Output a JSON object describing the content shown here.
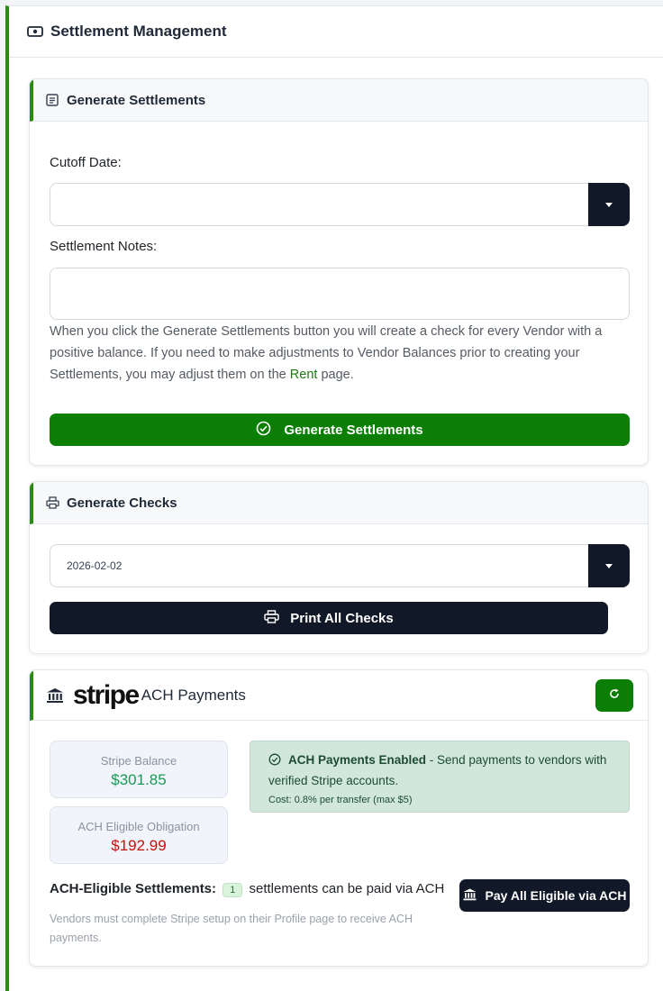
{
  "page": {
    "title": "Settlement Management",
    "icon": "money-icon"
  },
  "generate_settlements": {
    "title": "Generate Settlements",
    "icon": "document-icon",
    "cutoff_label": "Cutoff Date:",
    "cutoff_value": "",
    "notes_label": "Settlement Notes:",
    "notes_value": "",
    "help_before": "When you click the Generate Settlements button you will create a check for every Vendor with a positive balance. If you need to make adjustments to Vendor Balances prior to creating your Settlements, you may adjust them on the ",
    "help_link": "Rent",
    "help_after": " page.",
    "button_label": "Generate Settlements",
    "button_icon": "check-circle-icon"
  },
  "generate_checks": {
    "title": "Generate Checks",
    "icon": "printer-icon",
    "date_value": "2026-02-02",
    "button_label": "Print All Checks",
    "button_icon": "printer-icon"
  },
  "ach": {
    "brand": "stripe",
    "title": "ACH Payments",
    "icon": "bank-icon",
    "refresh_icon": "refresh-icon",
    "stripe_balance_label": "Stripe Balance",
    "stripe_balance_value": "$301.85",
    "obligation_label": "ACH Eligible Obligation",
    "obligation_value": "$192.99",
    "alert_title": "ACH Payments Enabled",
    "alert_text": " - Send payments to vendors with verified Stripe accounts.",
    "alert_cost": "Cost: 0.8% per transfer (max $5)",
    "eligible_label": "ACH-Eligible Settlements:",
    "eligible_count": "1",
    "eligible_text": "settlements can be paid via ACH",
    "note": "Vendors must complete Stripe setup on their Profile page to receive ACH payments.",
    "pay_button": "Pay All Eligible via ACH",
    "pay_icon": "bank-icon"
  },
  "colors": {
    "accent_green": "#0b7f05",
    "dark_button": "#111827",
    "balance_green": "#1b9a55",
    "obligation_red": "#c8100b"
  }
}
